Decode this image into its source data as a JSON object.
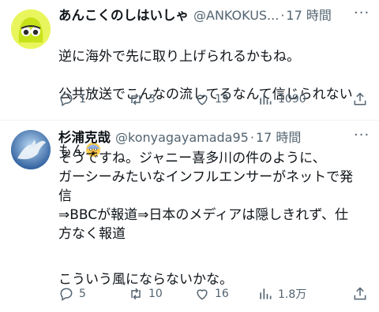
{
  "tweets": [
    {
      "name": "あんこくのしはいしゃ",
      "handle": "@ANKOKUS...",
      "dot": "·",
      "time": "17 時間",
      "line1": "逆に海外で先に取り上げられるかもね。",
      "line2": "公共放送でこんなの流してるなんて信じられない",
      "line3": "もん",
      "replies": "1",
      "retweets": "3",
      "likes": "15",
      "views": "1090"
    },
    {
      "name": "杉浦克哉",
      "handle": "@konyagayamada95",
      "dot": "·",
      "time": "17 時間",
      "lines": [
        "そうですね。ジャニー喜多川の件のように、",
        "ガーシーみたいなインフルエンサーがネットで発",
        "信",
        "⇒BBCが報道⇒日本のメディアは隠しきれず、仕",
        "方なく報道",
        "",
        "こういう風にならないかな。"
      ],
      "replies": "5",
      "retweets": "10",
      "likes": "16",
      "views": "1.8万"
    }
  ],
  "colors": {
    "text": "#0f1419",
    "muted": "#536471",
    "avatar1": "#d9f03a",
    "avatar2": "#3a6fb0"
  },
  "icons": [
    "reply-icon",
    "retweet-icon",
    "like-icon",
    "views-icon",
    "share-icon",
    "more-icon",
    "scream-emoji"
  ]
}
